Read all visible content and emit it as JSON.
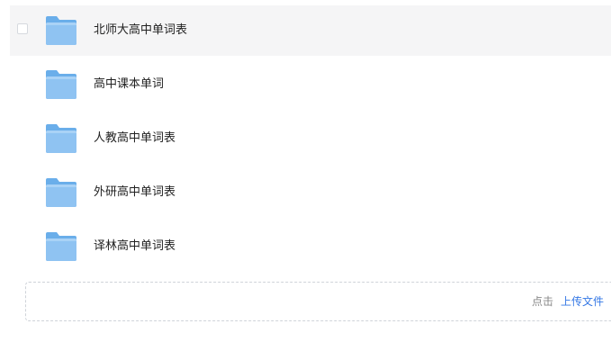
{
  "folders": [
    {
      "name": "北师大高中单词表",
      "icon": "folder-icon",
      "hovered": true
    },
    {
      "name": "高中课本单词",
      "icon": "folder-icon",
      "hovered": false
    },
    {
      "name": "人教高中单词表",
      "icon": "folder-icon",
      "hovered": false
    },
    {
      "name": "外研高中单词表",
      "icon": "folder-icon",
      "hovered": false
    },
    {
      "name": "译林高中单词表",
      "icon": "folder-icon",
      "hovered": false
    }
  ],
  "upload": {
    "prefix": "点击",
    "link": "上传文件"
  },
  "colors": {
    "folder_body": "#8fc3f2",
    "folder_tab": "#6aaeea",
    "link": "#3578e5",
    "hover_bg": "#f5f5f6"
  }
}
